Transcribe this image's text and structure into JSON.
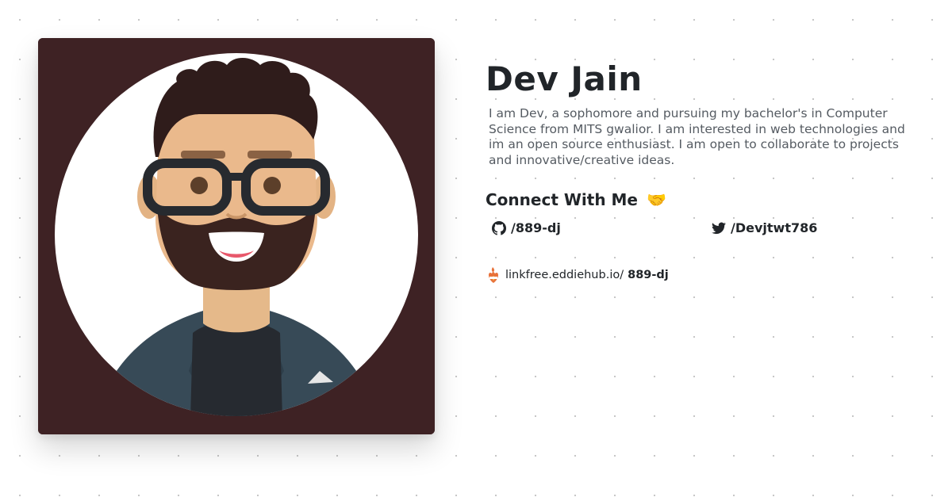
{
  "profile": {
    "name": "Dev Jain",
    "bio": "I am Dev, a sophomore and pursuing my bachelor's in Computer Science from MITS gwalior. I am interested in web technologies and im an open source enthusiast. I am open to collaborate to projects and innovative/creative ideas.",
    "avatar_alt": "cartoon avatar"
  },
  "connect": {
    "heading": "Connect With Me",
    "emoji": "🤝"
  },
  "socials": {
    "github": {
      "icon": "github-icon",
      "label": "/889-dj"
    },
    "twitter": {
      "icon": "twitter-icon",
      "label": "/Devjtwt786"
    }
  },
  "linkfree": {
    "icon": "linkfree-logo-icon",
    "prefix": "linkfree.eddiehub.io/",
    "handle": "889-dj"
  },
  "colors": {
    "card_background": "#3e2224",
    "heading_text": "#212529",
    "body_text": "#555b62",
    "dot_grid": "#c4c4c4"
  }
}
